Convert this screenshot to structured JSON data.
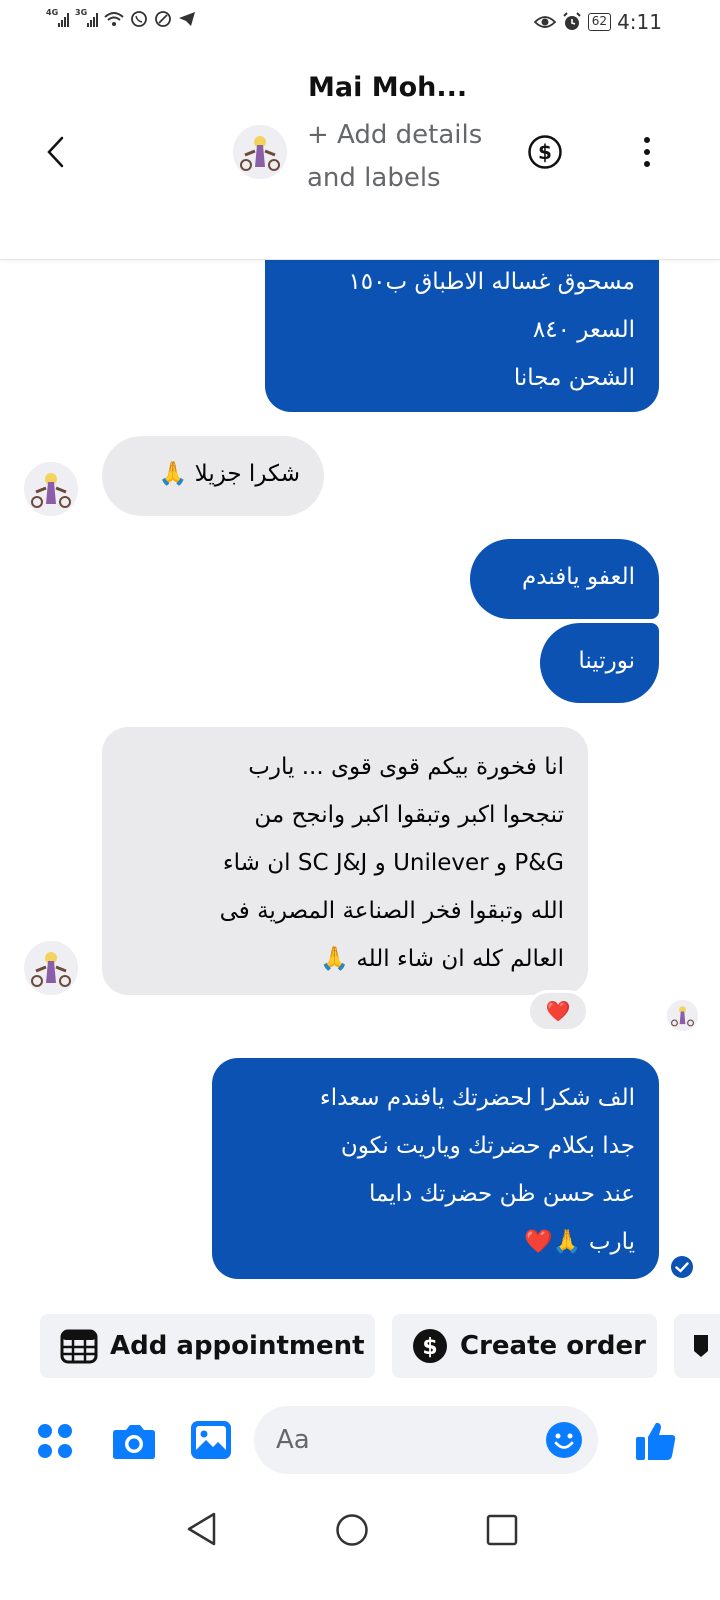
{
  "status_bar": {
    "network_1": "4G",
    "network_2": "3G",
    "battery": "62",
    "time": "4:11"
  },
  "header": {
    "contact_name": "Mai Moh...",
    "add_details": "+ Add details and labels",
    "back_icon": "chevron-left-icon",
    "dollar_icon": "dollar-circle-icon",
    "more_icon": "more-vertical-icon"
  },
  "messages": [
    {
      "side": "out",
      "lines": [
        "مسحوق غساله الاطباق ب١٥٠",
        "السعر ٨٤٠",
        "الشحن مجانا"
      ]
    },
    {
      "side": "in",
      "lines": [
        "شكرا جزيلا 🙏"
      ]
    },
    {
      "side": "out",
      "lines": [
        "العفو يافندم"
      ]
    },
    {
      "side": "out",
      "lines": [
        "نورتينا"
      ]
    },
    {
      "side": "in",
      "lines": [
        "انا فخورة بيكم قوى قوى ... يارب",
        "تنجحوا اكبر وتبقوا اكبر وانجح من",
        "P&G و Unilever و SC J&J ان شاء",
        "الله وتبقوا فخر الصناعة المصرية فى",
        "العالم كله ان شاء الله 🙏"
      ],
      "reaction": "❤️"
    },
    {
      "side": "out",
      "lines": [
        "الف شكرا لحضرتك يافندم سعداء",
        "جدا بكلام حضرتك وياريت نكون",
        "عند حسن ظن حضرتك دايما",
        "يارب 🙏❤️"
      ]
    }
  ],
  "quick_actions": [
    {
      "label": "Add appointment",
      "icon": "calendar-icon"
    },
    {
      "label": "Create order",
      "icon": "dollar-circle-icon"
    }
  ],
  "composer": {
    "placeholder": "Aa",
    "icons": [
      "menu-dots-icon",
      "camera-icon",
      "gallery-icon",
      "emoji-icon",
      "thumbs-up-icon"
    ]
  },
  "colors": {
    "outgoing_bubble": "#0c52b2",
    "incoming_bubble": "#eaeaec",
    "accent": "#0a7cff"
  }
}
